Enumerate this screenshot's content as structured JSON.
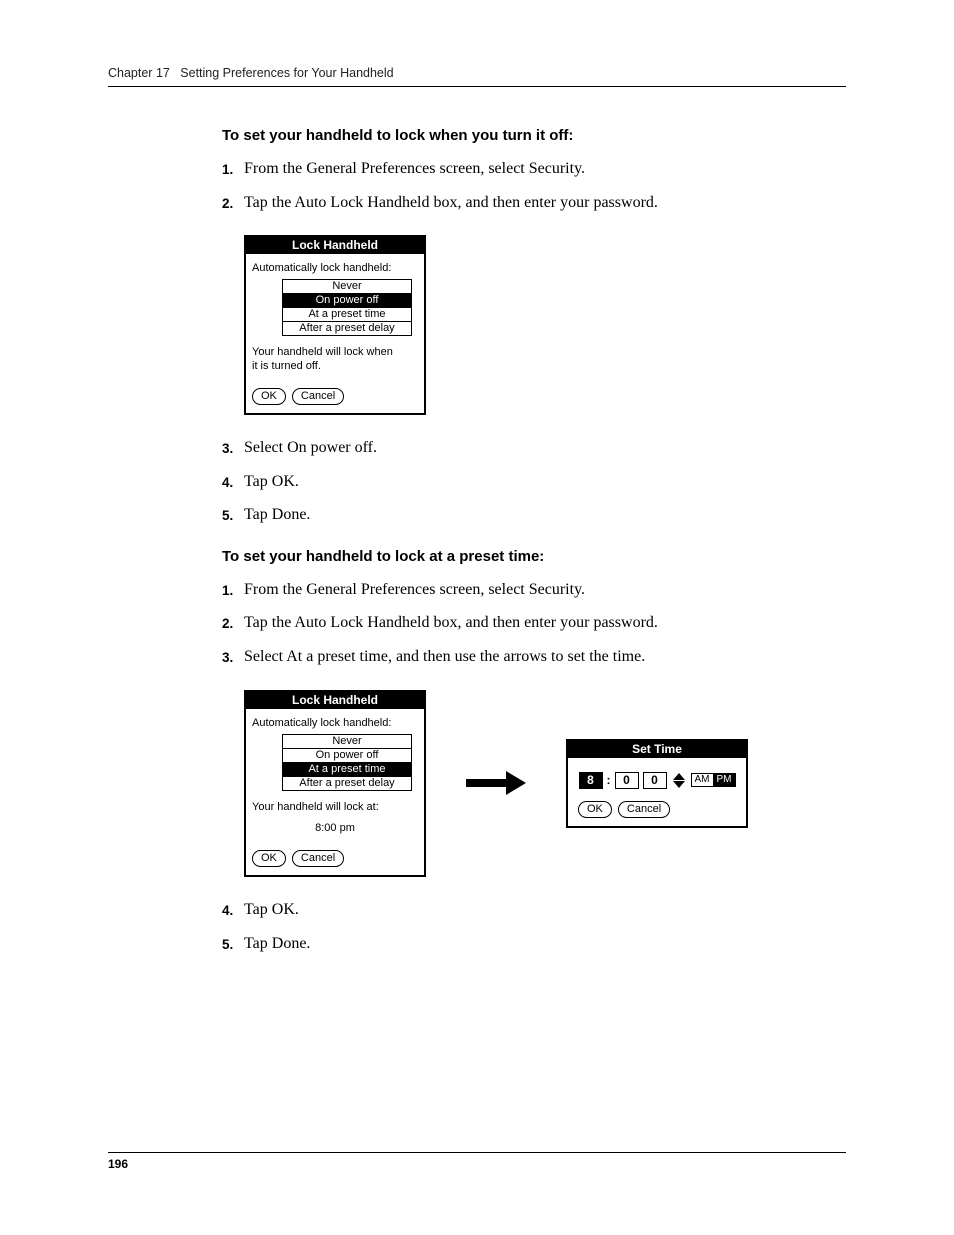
{
  "header": {
    "chapter_label": "Chapter 17",
    "chapter_title": "Setting Preferences for Your Handheld"
  },
  "section1": {
    "heading": "To set your handheld to lock when you turn it off:",
    "steps_pre": [
      "From the General Preferences screen, select Security.",
      "Tap the Auto Lock Handheld box, and then enter your password."
    ],
    "steps_post": [
      "Select On power off.",
      "Tap OK.",
      "Tap Done."
    ]
  },
  "section2": {
    "heading": "To set your handheld to lock at a preset time:",
    "steps_pre": [
      "From the General Preferences screen, select Security.",
      "Tap the Auto Lock Handheld box, and then enter your password.",
      "Select At a preset time, and then use the arrows to set the time."
    ],
    "steps_post": [
      "Tap OK.",
      "Tap Done."
    ]
  },
  "dialog_lock": {
    "title": "Lock Handheld",
    "prompt": "Automatically lock handheld:",
    "options": [
      "Never",
      "On power off",
      "At a preset time",
      "After a preset delay"
    ],
    "msg_poweroff_line1": "Your handheld will lock when",
    "msg_poweroff_line2": "it is turned off.",
    "msg_preset_line1": "Your handheld will lock at:",
    "msg_preset_time": "8:00 pm",
    "ok": "OK",
    "cancel": "Cancel"
  },
  "dialog_time": {
    "title": "Set Time",
    "hour": "8",
    "min_tens": "0",
    "min_ones": "0",
    "am": "AM",
    "pm": "PM",
    "ok": "OK",
    "cancel": "Cancel"
  },
  "page_number": "196"
}
